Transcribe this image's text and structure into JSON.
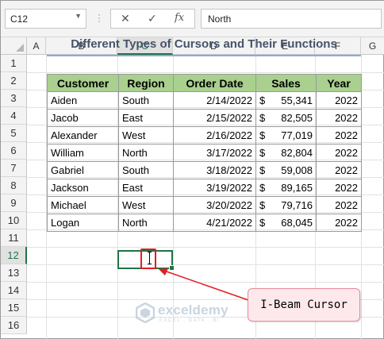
{
  "formula_bar": {
    "name_box": "C12",
    "cancel_icon": "cancel-icon",
    "enter_icon": "enter-icon",
    "fx_label": "fx",
    "formula_value": "North"
  },
  "columns": [
    "A",
    "B",
    "C",
    "D",
    "E",
    "F",
    "G"
  ],
  "selected_column": "C",
  "rows": [
    "1",
    "2",
    "3",
    "4",
    "5",
    "6",
    "7",
    "8",
    "9",
    "10",
    "11",
    "12",
    "13",
    "14",
    "15",
    "16"
  ],
  "selected_row": "12",
  "sheet": {
    "title": "Different Types of Cursors and Their Functions",
    "headers": [
      "Customer",
      "Region",
      "Order Date",
      "Sales",
      "Year"
    ],
    "rows": [
      {
        "customer": "Aiden",
        "region": "South",
        "date": "2/14/2022",
        "currency": "$",
        "sales": "55,341",
        "year": "2022"
      },
      {
        "customer": "Jacob",
        "region": "East",
        "date": "2/15/2022",
        "currency": "$",
        "sales": "82,505",
        "year": "2022"
      },
      {
        "customer": "Alexander",
        "region": "West",
        "date": "2/16/2022",
        "currency": "$",
        "sales": "77,019",
        "year": "2022"
      },
      {
        "customer": "William",
        "region": "North",
        "date": "3/17/2022",
        "currency": "$",
        "sales": "82,804",
        "year": "2022"
      },
      {
        "customer": "Gabriel",
        "region": "South",
        "date": "3/18/2022",
        "currency": "$",
        "sales": "59,008",
        "year": "2022"
      },
      {
        "customer": "Jackson",
        "region": "East",
        "date": "3/19/2022",
        "currency": "$",
        "sales": "89,165",
        "year": "2022"
      },
      {
        "customer": "Michael",
        "region": "West",
        "date": "3/20/2022",
        "currency": "$",
        "sales": "79,716",
        "year": "2022"
      },
      {
        "customer": "Logan",
        "region": "North",
        "date": "4/21/2022",
        "currency": "$",
        "sales": "68,045",
        "year": "2022"
      }
    ]
  },
  "callout": {
    "label": "I-Beam Cursor"
  },
  "watermark": {
    "name": "exceldemy",
    "tagline": "EXCEL · DATA · BI"
  },
  "colors": {
    "header_fill": "#a9d08e",
    "title_text": "#44546a",
    "accent_green": "#217346",
    "annotation_red": "#e31b23",
    "callout_fill": "#fde9ec"
  }
}
